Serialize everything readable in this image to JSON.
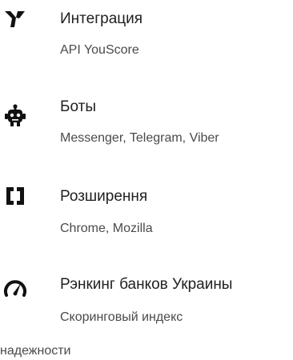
{
  "items": [
    {
      "title": "Интеграция",
      "subtitle": "API YouScore",
      "icon": "y-logo-icon"
    },
    {
      "title": "Боты",
      "subtitle": "Messenger, Telegram, Viber",
      "icon": "robot-icon"
    },
    {
      "title": "Розширення",
      "subtitle": "Chrome, Mozilla",
      "icon": "brackets-icon"
    },
    {
      "title": "Рэнкинг банков Украины",
      "subtitle": "Скоринговый индекс",
      "subtitle_cont": "надежности",
      "icon": "speedometer-icon"
    }
  ],
  "colors": {
    "icon": "#111111",
    "title": "#212121",
    "subtitle": "#4a4a4a"
  }
}
